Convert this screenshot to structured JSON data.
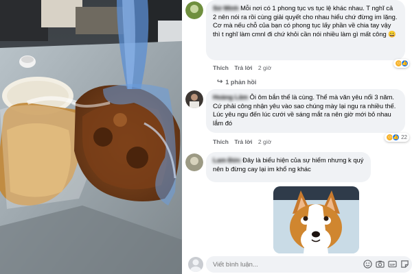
{
  "photo": {
    "icon": "food-bags-photo"
  },
  "comments": [
    {
      "author": "Sử Minh",
      "text": "Mỗi nơi có 1 phong tục vs tục lệ khác nhau. T nghĩ cả 2 nên nói ra rồi cùng giải quyết cho nhau hiểu chứ đừng im lặng. Cơ mà nếu chỗ của bạn có phong tục lấy phần về chia tay vậy thì t nghĩ làm cmnl đi chứ khỏi cần nói nhiều làm gì mất công 😀",
      "like_label": "Thích",
      "reply_label": "Trả lời",
      "time": "2 giờ",
      "reactions": {
        "count": ""
      }
    },
    {
      "author": "Hoàng Lâm",
      "text": "Ôi ôm bắn thể là cùng. Thể mà văn yêu nổi 3 năm. Cứ phải công nhận yêu vào sao chúng mày lại ngu ra nhiều thế. Lúc yêu ngu đến lúc cưới về sáng mắt ra nên giờ mới bỏ nhau lắm đó",
      "like_label": "Thích",
      "reply_label": "Trả lời",
      "time": "2 giờ",
      "reactions": {
        "count": "22"
      }
    },
    {
      "author": "Lam Đức",
      "text": "Đây là biểu hiện của sự hiểm nhưng k quý nên b đừng cay lại im khổ ng khác",
      "like_label": "Thích",
      "reply_label": "Trả lời",
      "time": "2 giờ"
    }
  ],
  "reply_link": "1 phản hồi",
  "composer": {
    "placeholder": "Viết bình luận..."
  },
  "colors": {
    "bubble": "#f0f2f5",
    "meta": "#65676b",
    "like": "#1877f2",
    "haha": "#f7b125"
  }
}
